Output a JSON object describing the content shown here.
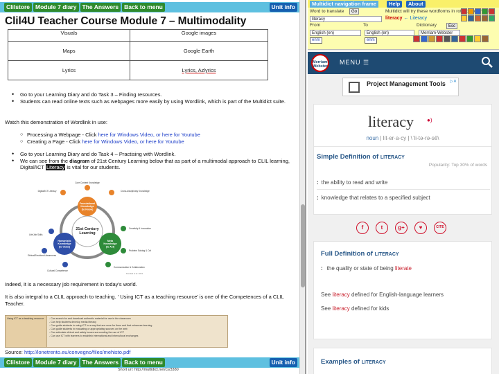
{
  "left": {
    "nav_top": {
      "items": [
        "Clilstore",
        "Module 7 diary",
        "The Answers",
        "Back to menu"
      ],
      "unit_info": "Unit info"
    },
    "page_title": "Clil4U Teacher Course Module 7 – Multimodality",
    "media_table": [
      {
        "type": "Visuals",
        "tool": "Google images"
      },
      {
        "type": "Maps",
        "tool": "Google Earth"
      },
      {
        "type": "Lyrics",
        "tool": "Lyrics, Azlyrics"
      }
    ],
    "bullets1": [
      "Go to your Learning Diary and do Task 3 – Finding resources.",
      "Students can read online texts such as webpages more easily by using Wordlink, which is part of the Multidict suite."
    ],
    "watch_line": "Watch this demonstration of Wordlink in use:",
    "sub_items": [
      {
        "label": "Processing a Webpage - Click ",
        "link": "here for Windows Video, or here for Youtube"
      },
      {
        "label": "Creating a Page - Click ",
        "link": "here for Windows Video, or here for Youtube"
      }
    ],
    "bullets2": [
      "Go to your Learning Diary and do Task 4 – Practising with Wordlink.",
      "We can see from the diagram of 21st Century Learning below that as part of a multimodal approach to CLIL learning, Digital/ICT Literacy is vital for our students."
    ],
    "highlight_word": "Literacy",
    "diagram": {
      "center": "21st Century Learning",
      "nodes": [
        "Foundational Knowledge (to Know)",
        "Humanistic Knowledge (to Value)",
        "Meta Knowledge (to Act)"
      ],
      "labels": [
        "Core Content Knowledge",
        "Cross-disciplinary Knowledge",
        "Digital/ICT Literacy",
        "Creativity & Innovation",
        "Problem Solving & Critical Thinking",
        "Communication & Collaboration",
        "Life/Job Skills",
        "Ethical/Emotional Awareness",
        "Cultural Competence"
      ],
      "credit": "Kereluik et al. 2013"
    },
    "para1": "Indeed, it is a necessary job requirement in today's world.",
    "para2": "It is also integral to a CLIL approach to teaching. ' Using ICT as a teaching resource' is one of the Competences of a CLIL Teacher.",
    "comp_table": {
      "left": "Using ICT as a teaching resource",
      "right": [
        "- Can search for and download authentic material for use in the classroom",
        "- Can help students develop media literacy",
        "- Can guide students in using ICT in a way that are more for them and that enhances learning",
        "- Can guide students in evaluating or appropriating sources on the web",
        "- Can articulate ethical and safety issues surrounding the use of ICT",
        "- Can use ICT with learners to establish international and intercultural exchanges"
      ]
    },
    "source_label": "Source: ",
    "source_link": "http://lonetrento.eu/convegno/files/mehisto.pdf",
    "nav_bottom": {
      "items": [
        "Clilstore",
        "Module 7 diary",
        "The Answers",
        "Back to menu"
      ],
      "unit_info": "Unit info"
    },
    "short_url": "Short url:   http://multidict.net/cs/3380"
  },
  "multidict": {
    "title": "Multidict navigation frame",
    "help": "Help",
    "about": "About",
    "word_label": "Word to translate",
    "word_value": "literacy",
    "go": "Go",
    "notice": "Multidict will try these wordforms in rotation (on reclick)",
    "wordforms_1": "literacy",
    "wordforms_2": "← Literacy",
    "from_label": "From",
    "to_label": "To",
    "from_value": "English (en)",
    "to_value": "English (en)",
    "dictionary_label": "Dictionary",
    "dictionary_value": "Merriam-Webster",
    "esc": "Esc",
    "enm": "enm"
  },
  "merriam": {
    "logo": "Merriam-Webster",
    "menu": "MENU",
    "ad_title": "Project Management Tools",
    "headword": "literacy",
    "pos": "noun",
    "pron": "| lit·er·a·cy |    \\ˈli-tə-rə-sē\\",
    "simple_def_heading": "Simple Definition of",
    "simple_def_word": "LITERACY",
    "popularity": "Popularity: Top 30% of words",
    "simple_defs": [
      "the ability to read and write",
      "knowledge that relates to a specified subject"
    ],
    "share_icons": [
      "f",
      "t",
      "g+",
      "♥",
      "CITE"
    ],
    "full_def_heading": "Full Definition of",
    "full_def_word": "LITERACY",
    "full_def_pre": "the quality or state of being ",
    "full_def_link": "literate",
    "see_lines": [
      {
        "pre": "See ",
        "link": "literacy",
        "post": " defined for English-language learners"
      },
      {
        "pre": "See ",
        "link": "literacy",
        "post": " defined for kids"
      }
    ],
    "examples_heading": "Examples of",
    "examples_word": "LITERACY"
  }
}
